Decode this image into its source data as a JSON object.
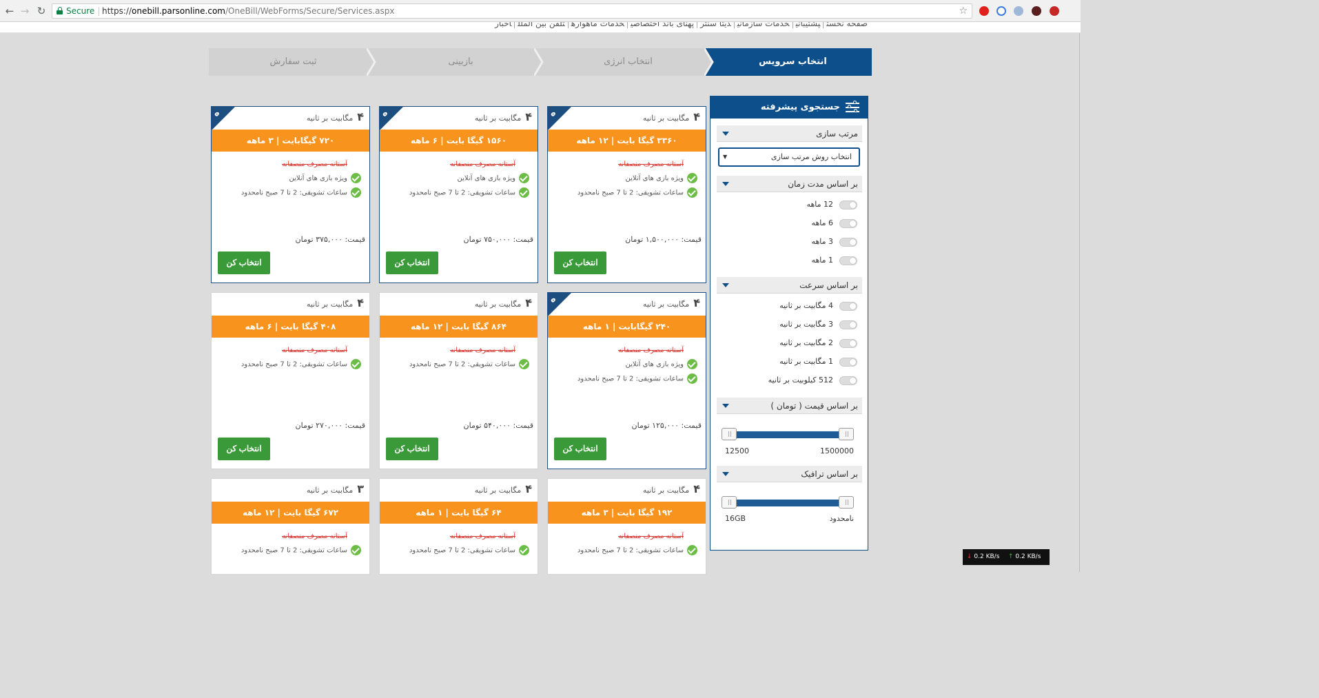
{
  "browser": {
    "secure_label": "Secure",
    "url_prefix": "https://",
    "url_domain": "onebill.parsonline.com",
    "url_path": "/OneBill/WebForms/Secure/Services.aspx"
  },
  "top_links": [
    "صفحه نخست",
    "پشتیبانی",
    "خدمات سازمانی",
    "دیتا سنتر",
    "پهنای باند اختصاصی",
    "خدمات ماهواره",
    "تلفن بین الملل",
    "اخبار"
  ],
  "steps": [
    "انتخاب سرویس",
    "انتخاب انرژی",
    "بازبینی",
    "ثبت سفارش"
  ],
  "sidebar": {
    "title": "جستجوی پیشرفته",
    "sort": {
      "heading": "مرتب سازی",
      "select_value": "انتخاب روش مرتب سازی"
    },
    "duration": {
      "heading": "بر اساس مدت زمان",
      "options": [
        "12 ماهه",
        "6 ماهه",
        "3 ماهه",
        "1 ماهه"
      ]
    },
    "speed": {
      "heading": "بر اساس سرعت",
      "options": [
        "4 مگابیت بر ثانیه",
        "3 مگابیت بر ثانیه",
        "2 مگابیت بر ثانیه",
        "1 مگابیت بر ثانیه",
        "512 کیلوبیت بر ثانیه"
      ]
    },
    "price": {
      "heading": "بر اساس قیمت ( تومان )",
      "min": "12500",
      "max": "1500000"
    },
    "traffic": {
      "heading": "بر اساس ترافیک",
      "min": "16GB",
      "max": "نامحدود"
    }
  },
  "cards": [
    {
      "speed_num": "۴",
      "speed_unit": "مگابیت بر ثانیه",
      "title": "۳۳۶۰ گیگا بایت | ۱۲ ماهه",
      "promo": "آستانه مصرف منصفانه",
      "features": [
        "ویژه بازی های آنلاین",
        "ساعات تشویقی: 2 تا 7 صبح نامحدود"
      ],
      "price": "قیمت: ۱,۵۰۰,۰۰۰ تومان",
      "button": "انتخاب کن",
      "badge": "ه"
    },
    {
      "speed_num": "۴",
      "speed_unit": "مگابیت بر ثانیه",
      "title": "۱۵۶۰ گیگا بایت | ۶ ماهه",
      "promo": "آستانه مصرف منصفانه",
      "features": [
        "ویژه بازی های آنلاین",
        "ساعات تشویقی: 2 تا 7 صبح نامحدود"
      ],
      "price": "قیمت: ۷۵۰,۰۰۰ تومان",
      "button": "انتخاب کن",
      "badge": "ه"
    },
    {
      "speed_num": "۴",
      "speed_unit": "مگابیت بر ثانیه",
      "title": "۷۲۰ گیگابایت | ۳ ماهه",
      "promo": "آستانه مصرف منصفانه",
      "features": [
        "ویژه بازی های آنلاین",
        "ساعات تشویقی: 2 تا 7 صبح نامحدود"
      ],
      "price": "قیمت: ۳۷۵,۰۰۰ تومان",
      "button": "انتخاب کن",
      "badge": "ه"
    },
    {
      "speed_num": "۴",
      "speed_unit": "مگابیت بر ثانیه",
      "title": "۲۴۰ گیگابایت | ۱ ماهه",
      "promo": "آستانه مصرف منصفانه",
      "features": [
        "ویژه بازی های آنلاین",
        "ساعات تشویقی: 2 تا 7 صبح نامحدود"
      ],
      "price": "قیمت: ۱۲۵,۰۰۰ تومان",
      "button": "انتخاب کن",
      "badge": "ه"
    },
    {
      "speed_num": "۴",
      "speed_unit": "مگابیت بر ثانیه",
      "title": "۸۶۴ گیگا بایت | ۱۲ ماهه",
      "promo": "آستانه مصرف منصفانه",
      "features": [
        "ساعات تشویقی: 2 تا 7 صبح نامحدود"
      ],
      "price": "قیمت: ۵۴۰,۰۰۰ تومان",
      "button": "انتخاب کن"
    },
    {
      "speed_num": "۴",
      "speed_unit": "مگابیت بر ثانیه",
      "title": "۴۰۸ گیگا بایت | ۶ ماهه",
      "promo": "آستانه مصرف منصفانه",
      "features": [
        "ساعات تشویقی: 2 تا 7 صبح نامحدود"
      ],
      "price": "قیمت: ۲۷۰,۰۰۰ تومان",
      "button": "انتخاب کن"
    },
    {
      "speed_num": "۴",
      "speed_unit": "مگابیت بر ثانیه",
      "title": "۱۹۲ گیگا بایت | ۳ ماهه",
      "promo": "آستانه مصرف منصفانه",
      "features": [
        "ساعات تشویقی: 2 تا 7 صبح نامحدود"
      ]
    },
    {
      "speed_num": "۴",
      "speed_unit": "مگابیت بر ثانیه",
      "title": "۶۴ گیگا بایت | ۱ ماهه",
      "promo": "آستانه مصرف منصفانه",
      "features": [
        "ساعات تشویقی: 2 تا 7 صبح نامحدود"
      ]
    },
    {
      "speed_num": "۳",
      "speed_unit": "مگابیت بر ثانیه",
      "title": "۶۷۲ گیگا بایت | ۱۲ ماهه",
      "promo": "آستانه مصرف منصفانه",
      "features": [
        "ساعات تشویقی: 2 تا 7 صبح نامحدود"
      ]
    }
  ],
  "net_meter": {
    "down": "0.2 KB/s",
    "up": "0.2 KB/s"
  },
  "colors": {
    "brand_blue": "#0d4f8b",
    "orange": "#f8931d",
    "green_button": "#3a9a3a",
    "check_green": "#6cbd45"
  }
}
